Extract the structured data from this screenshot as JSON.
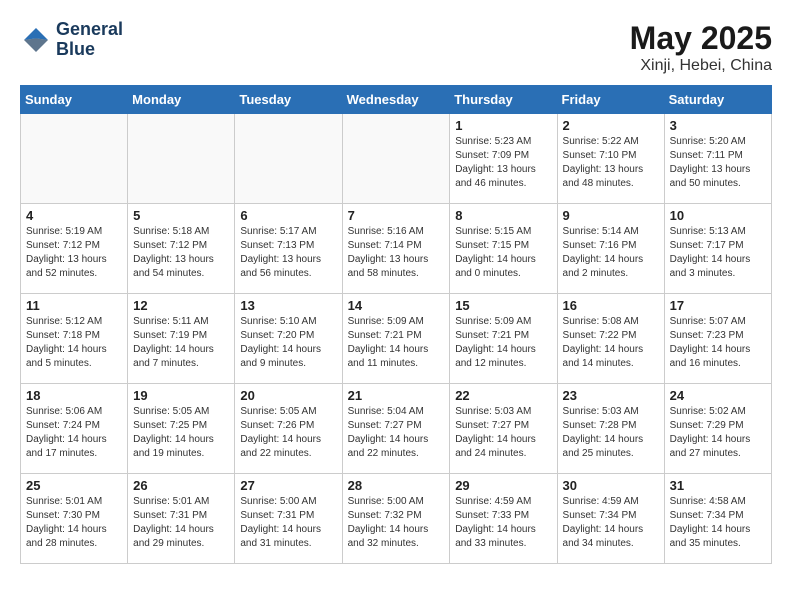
{
  "header": {
    "logo_line1": "General",
    "logo_line2": "Blue",
    "month": "May 2025",
    "location": "Xinji, Hebei, China"
  },
  "weekdays": [
    "Sunday",
    "Monday",
    "Tuesday",
    "Wednesday",
    "Thursday",
    "Friday",
    "Saturday"
  ],
  "weeks": [
    [
      {
        "day": "",
        "content": ""
      },
      {
        "day": "",
        "content": ""
      },
      {
        "day": "",
        "content": ""
      },
      {
        "day": "",
        "content": ""
      },
      {
        "day": "1",
        "content": "Sunrise: 5:23 AM\nSunset: 7:09 PM\nDaylight: 13 hours\nand 46 minutes."
      },
      {
        "day": "2",
        "content": "Sunrise: 5:22 AM\nSunset: 7:10 PM\nDaylight: 13 hours\nand 48 minutes."
      },
      {
        "day": "3",
        "content": "Sunrise: 5:20 AM\nSunset: 7:11 PM\nDaylight: 13 hours\nand 50 minutes."
      }
    ],
    [
      {
        "day": "4",
        "content": "Sunrise: 5:19 AM\nSunset: 7:12 PM\nDaylight: 13 hours\nand 52 minutes."
      },
      {
        "day": "5",
        "content": "Sunrise: 5:18 AM\nSunset: 7:12 PM\nDaylight: 13 hours\nand 54 minutes."
      },
      {
        "day": "6",
        "content": "Sunrise: 5:17 AM\nSunset: 7:13 PM\nDaylight: 13 hours\nand 56 minutes."
      },
      {
        "day": "7",
        "content": "Sunrise: 5:16 AM\nSunset: 7:14 PM\nDaylight: 13 hours\nand 58 minutes."
      },
      {
        "day": "8",
        "content": "Sunrise: 5:15 AM\nSunset: 7:15 PM\nDaylight: 14 hours\nand 0 minutes."
      },
      {
        "day": "9",
        "content": "Sunrise: 5:14 AM\nSunset: 7:16 PM\nDaylight: 14 hours\nand 2 minutes."
      },
      {
        "day": "10",
        "content": "Sunrise: 5:13 AM\nSunset: 7:17 PM\nDaylight: 14 hours\nand 3 minutes."
      }
    ],
    [
      {
        "day": "11",
        "content": "Sunrise: 5:12 AM\nSunset: 7:18 PM\nDaylight: 14 hours\nand 5 minutes."
      },
      {
        "day": "12",
        "content": "Sunrise: 5:11 AM\nSunset: 7:19 PM\nDaylight: 14 hours\nand 7 minutes."
      },
      {
        "day": "13",
        "content": "Sunrise: 5:10 AM\nSunset: 7:20 PM\nDaylight: 14 hours\nand 9 minutes."
      },
      {
        "day": "14",
        "content": "Sunrise: 5:09 AM\nSunset: 7:21 PM\nDaylight: 14 hours\nand 11 minutes."
      },
      {
        "day": "15",
        "content": "Sunrise: 5:09 AM\nSunset: 7:21 PM\nDaylight: 14 hours\nand 12 minutes."
      },
      {
        "day": "16",
        "content": "Sunrise: 5:08 AM\nSunset: 7:22 PM\nDaylight: 14 hours\nand 14 minutes."
      },
      {
        "day": "17",
        "content": "Sunrise: 5:07 AM\nSunset: 7:23 PM\nDaylight: 14 hours\nand 16 minutes."
      }
    ],
    [
      {
        "day": "18",
        "content": "Sunrise: 5:06 AM\nSunset: 7:24 PM\nDaylight: 14 hours\nand 17 minutes."
      },
      {
        "day": "19",
        "content": "Sunrise: 5:05 AM\nSunset: 7:25 PM\nDaylight: 14 hours\nand 19 minutes."
      },
      {
        "day": "20",
        "content": "Sunrise: 5:05 AM\nSunset: 7:26 PM\nDaylight: 14 hours\nand 22 minutes."
      },
      {
        "day": "21",
        "content": "Sunrise: 5:04 AM\nSunset: 7:27 PM\nDaylight: 14 hours\nand 22 minutes."
      },
      {
        "day": "22",
        "content": "Sunrise: 5:03 AM\nSunset: 7:27 PM\nDaylight: 14 hours\nand 24 minutes."
      },
      {
        "day": "23",
        "content": "Sunrise: 5:03 AM\nSunset: 7:28 PM\nDaylight: 14 hours\nand 25 minutes."
      },
      {
        "day": "24",
        "content": "Sunrise: 5:02 AM\nSunset: 7:29 PM\nDaylight: 14 hours\nand 27 minutes."
      }
    ],
    [
      {
        "day": "25",
        "content": "Sunrise: 5:01 AM\nSunset: 7:30 PM\nDaylight: 14 hours\nand 28 minutes."
      },
      {
        "day": "26",
        "content": "Sunrise: 5:01 AM\nSunset: 7:31 PM\nDaylight: 14 hours\nand 29 minutes."
      },
      {
        "day": "27",
        "content": "Sunrise: 5:00 AM\nSunset: 7:31 PM\nDaylight: 14 hours\nand 31 minutes."
      },
      {
        "day": "28",
        "content": "Sunrise: 5:00 AM\nSunset: 7:32 PM\nDaylight: 14 hours\nand 32 minutes."
      },
      {
        "day": "29",
        "content": "Sunrise: 4:59 AM\nSunset: 7:33 PM\nDaylight: 14 hours\nand 33 minutes."
      },
      {
        "day": "30",
        "content": "Sunrise: 4:59 AM\nSunset: 7:34 PM\nDaylight: 14 hours\nand 34 minutes."
      },
      {
        "day": "31",
        "content": "Sunrise: 4:58 AM\nSunset: 7:34 PM\nDaylight: 14 hours\nand 35 minutes."
      }
    ]
  ]
}
